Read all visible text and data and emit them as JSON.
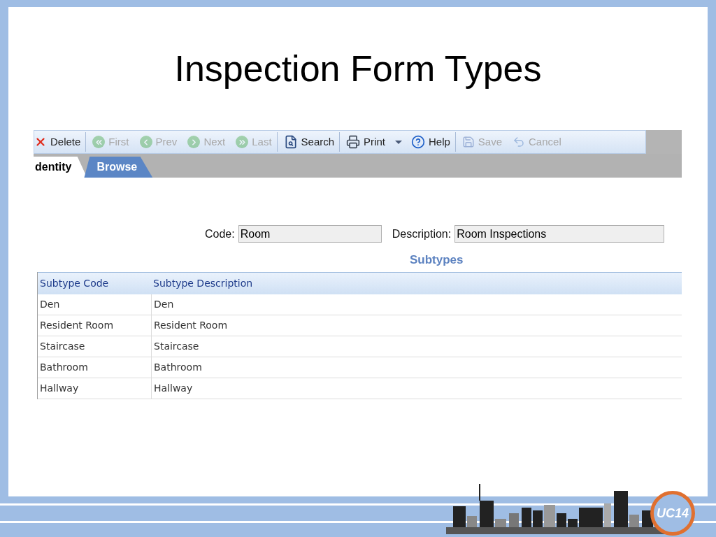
{
  "slide_title": "Inspection Form Types",
  "toolbar": [
    {
      "kind": "delete",
      "label": "Delete",
      "disabled": false,
      "separator_after": true
    },
    {
      "kind": "first",
      "label": "First",
      "disabled": true,
      "separator_after": false
    },
    {
      "kind": "prev",
      "label": "Prev",
      "disabled": true,
      "separator_after": false
    },
    {
      "kind": "next",
      "label": "Next",
      "disabled": true,
      "separator_after": false
    },
    {
      "kind": "last",
      "label": "Last",
      "disabled": true,
      "separator_after": true
    },
    {
      "kind": "search",
      "label": "Search",
      "disabled": false,
      "separator_after": true
    },
    {
      "kind": "print",
      "label": "Print",
      "disabled": false,
      "separator_after": false,
      "has_menu": true
    },
    {
      "kind": "help",
      "label": "Help",
      "disabled": false,
      "separator_after": true
    },
    {
      "kind": "save",
      "label": "Save",
      "disabled": true,
      "separator_after": false
    },
    {
      "kind": "cancel",
      "label": "Cancel",
      "disabled": true,
      "separator_after": false
    }
  ],
  "tabs": [
    {
      "label": "dentity",
      "selected": true
    },
    {
      "label": "Browse",
      "selected": false
    }
  ],
  "fields": [
    {
      "label": "Code:",
      "value": "Room"
    },
    {
      "label": "Description:",
      "value": "Room Inspections"
    }
  ],
  "subtypes": {
    "title": "Subtypes",
    "columns": [
      "Subtype Code",
      "Subtype Description"
    ],
    "rows": [
      [
        "Den",
        "Den"
      ],
      [
        "Resident Room",
        "Resident Room"
      ],
      [
        "Staircase",
        "Staircase"
      ],
      [
        "Bathroom",
        "Bathroom"
      ],
      [
        "Hallway",
        "Hallway"
      ]
    ]
  },
  "logo": {
    "text": "UC14"
  }
}
